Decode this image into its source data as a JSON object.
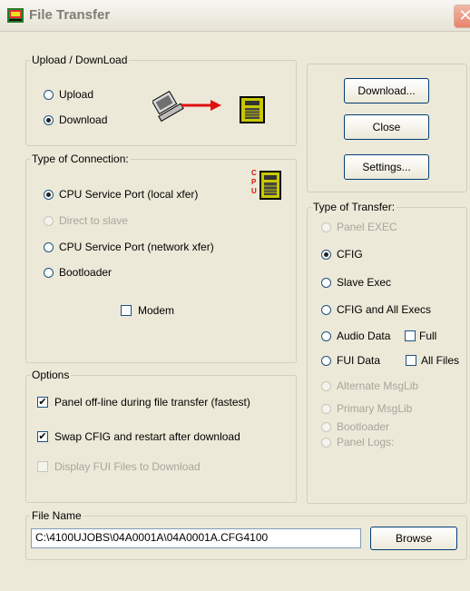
{
  "window": {
    "title": "File Transfer"
  },
  "upload_download": {
    "legend": "Upload / DownLoad",
    "upload_label": "Upload",
    "download_label": "Download",
    "selected": "Download"
  },
  "connection": {
    "legend": "Type of Connection:",
    "options": [
      {
        "label": "CPU Service Port (local xfer)",
        "selected": true,
        "enabled": true
      },
      {
        "label": "Direct to slave",
        "selected": false,
        "enabled": false
      },
      {
        "label": "CPU Service Port (network xfer)",
        "selected": false,
        "enabled": true
      },
      {
        "label": "Bootloader",
        "selected": false,
        "enabled": true
      }
    ],
    "modem_label": "Modem",
    "cpu_glyph": "CPU"
  },
  "options": {
    "legend": "Options",
    "panel_offline": {
      "label": "Panel off-line during file transfer (fastest)",
      "checked": true
    },
    "swap_cfig": {
      "label": "Swap CFIG and restart after download",
      "checked": true
    },
    "display_fui": {
      "label": "Display FUI Files to Download",
      "checked": false,
      "enabled": false
    }
  },
  "buttons": {
    "download": "Download...",
    "close": "Close",
    "settings": "Settings...",
    "browse": "Browse"
  },
  "transfer": {
    "legend": "Type of Transfer:",
    "options": [
      {
        "label": "Panel EXEC",
        "selected": false,
        "enabled": false
      },
      {
        "label": "CFIG",
        "selected": true,
        "enabled": true
      },
      {
        "label": "Slave Exec",
        "selected": false,
        "enabled": true
      },
      {
        "label": "CFIG and All Execs",
        "selected": false,
        "enabled": true
      },
      {
        "label": "Audio Data",
        "selected": false,
        "enabled": true
      },
      {
        "label": "FUI Data",
        "selected": false,
        "enabled": true
      },
      {
        "label": "Alternate MsgLib",
        "selected": false,
        "enabled": false
      },
      {
        "label": "Primary MsgLib",
        "selected": false,
        "enabled": false
      },
      {
        "label": "Bootloader",
        "selected": false,
        "enabled": false
      },
      {
        "label": "Panel Logs:",
        "selected": false,
        "enabled": false
      }
    ],
    "full_label": "Full",
    "all_files_label": "All Files"
  },
  "file_name": {
    "legend": "File Name",
    "value": "C:\\4100UJOBS\\04A0001A\\04A0001A.CFG4100"
  },
  "colors": {
    "face": "#ece9d8",
    "border": "#d0d0bf",
    "disabled_text": "#a7a69b",
    "panel_icon": "#c8c800",
    "arrow": "#e01010"
  }
}
